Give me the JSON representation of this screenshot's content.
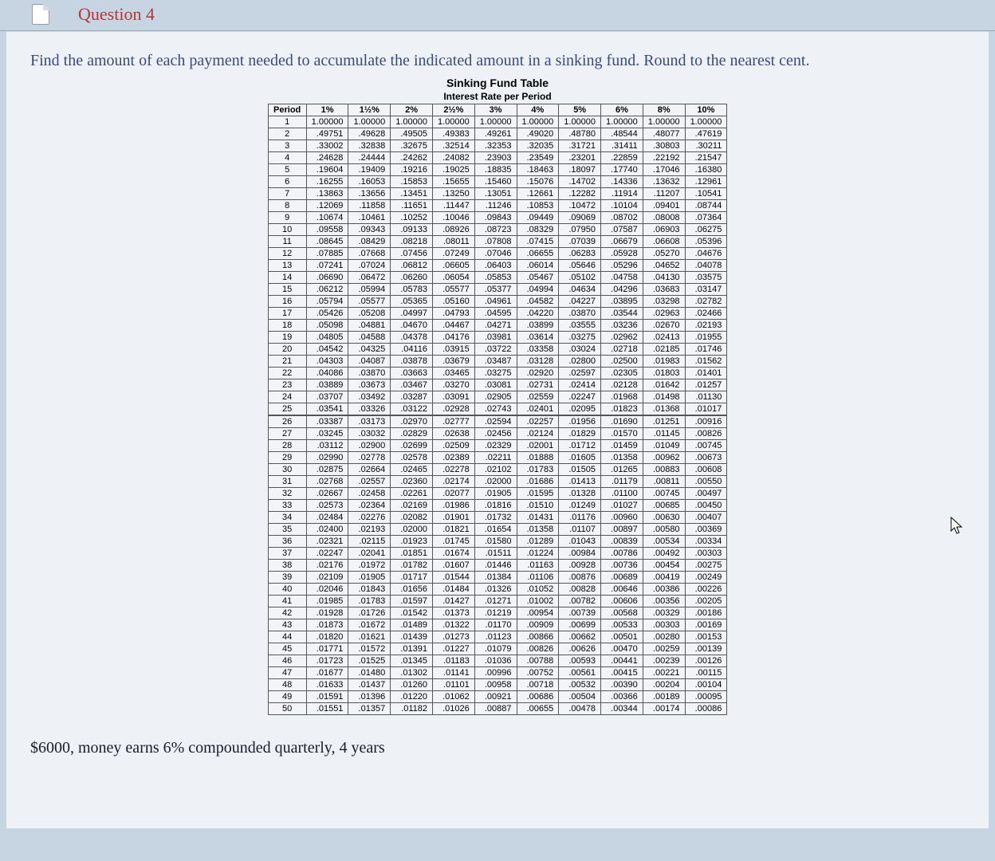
{
  "question_label": "Question 4",
  "prompt": "Find the amount of each payment needed to accumulate the indicated amount in a sinking fund. Round to the nearest cent.",
  "problem": "$6000, money earns 6% compounded quarterly, 4 years",
  "chart_data": {
    "type": "table",
    "title": "Sinking Fund Table",
    "subtitle": "Interest Rate per Period",
    "columns": [
      "Period",
      "1%",
      "1½%",
      "2%",
      "2½%",
      "3%",
      "4%",
      "5%",
      "6%",
      "8%",
      "10%"
    ],
    "rows": [
      [
        "1",
        "1.00000",
        "1.00000",
        "1.00000",
        "1.00000",
        "1.00000",
        "1.00000",
        "1.00000",
        "1.00000",
        "1.00000",
        "1.00000"
      ],
      [
        "2",
        ".49751",
        ".49628",
        ".49505",
        ".49383",
        ".49261",
        ".49020",
        ".48780",
        ".48544",
        ".48077",
        ".47619"
      ],
      [
        "3",
        ".33002",
        ".32838",
        ".32675",
        ".32514",
        ".32353",
        ".32035",
        ".31721",
        ".31411",
        ".30803",
        ".30211"
      ],
      [
        "4",
        ".24628",
        ".24444",
        ".24262",
        ".24082",
        ".23903",
        ".23549",
        ".23201",
        ".22859",
        ".22192",
        ".21547"
      ],
      [
        "5",
        ".19604",
        ".19409",
        ".19216",
        ".19025",
        ".18835",
        ".18463",
        ".18097",
        ".17740",
        ".17046",
        ".16380"
      ],
      [
        "6",
        ".16255",
        ".16053",
        ".15853",
        ".15655",
        ".15460",
        ".15076",
        ".14702",
        ".14336",
        ".13632",
        ".12961"
      ],
      [
        "7",
        ".13863",
        ".13656",
        ".13451",
        ".13250",
        ".13051",
        ".12661",
        ".12282",
        ".11914",
        ".11207",
        ".10541"
      ],
      [
        "8",
        ".12069",
        ".11858",
        ".11651",
        ".11447",
        ".11246",
        ".10853",
        ".10472",
        ".10104",
        ".09401",
        ".08744"
      ],
      [
        "9",
        ".10674",
        ".10461",
        ".10252",
        ".10046",
        ".09843",
        ".09449",
        ".09069",
        ".08702",
        ".08008",
        ".07364"
      ],
      [
        "10",
        ".09558",
        ".09343",
        ".09133",
        ".08926",
        ".08723",
        ".08329",
        ".07950",
        ".07587",
        ".06903",
        ".06275"
      ],
      [
        "11",
        ".08645",
        ".08429",
        ".08218",
        ".08011",
        ".07808",
        ".07415",
        ".07039",
        ".06679",
        ".06608",
        ".05396"
      ],
      [
        "12",
        ".07885",
        ".07668",
        ".07456",
        ".07249",
        ".07046",
        ".06655",
        ".06283",
        ".05928",
        ".05270",
        ".04676"
      ],
      [
        "13",
        ".07241",
        ".07024",
        ".06812",
        ".06605",
        ".06403",
        ".06014",
        ".05646",
        ".05296",
        ".04652",
        ".04078"
      ],
      [
        "14",
        ".06690",
        ".06472",
        ".06260",
        ".06054",
        ".05853",
        ".05467",
        ".05102",
        ".04758",
        ".04130",
        ".03575"
      ],
      [
        "15",
        ".06212",
        ".05994",
        ".05783",
        ".05577",
        ".05377",
        ".04994",
        ".04634",
        ".04296",
        ".03683",
        ".03147"
      ],
      [
        "16",
        ".05794",
        ".05577",
        ".05365",
        ".05160",
        ".04961",
        ".04582",
        ".04227",
        ".03895",
        ".03298",
        ".02782"
      ],
      [
        "17",
        ".05426",
        ".05208",
        ".04997",
        ".04793",
        ".04595",
        ".04220",
        ".03870",
        ".03544",
        ".02963",
        ".02466"
      ],
      [
        "18",
        ".05098",
        ".04881",
        ".04670",
        ".04467",
        ".04271",
        ".03899",
        ".03555",
        ".03236",
        ".02670",
        ".02193"
      ],
      [
        "19",
        ".04805",
        ".04588",
        ".04378",
        ".04176",
        ".03981",
        ".03614",
        ".03275",
        ".02962",
        ".02413",
        ".01955"
      ],
      [
        "20",
        ".04542",
        ".04325",
        ".04116",
        ".03915",
        ".03722",
        ".03358",
        ".03024",
        ".02718",
        ".02185",
        ".01746"
      ],
      [
        "21",
        ".04303",
        ".04087",
        ".03878",
        ".03679",
        ".03487",
        ".03128",
        ".02800",
        ".02500",
        ".01983",
        ".01562"
      ],
      [
        "22",
        ".04086",
        ".03870",
        ".03663",
        ".03465",
        ".03275",
        ".02920",
        ".02597",
        ".02305",
        ".01803",
        ".01401"
      ],
      [
        "23",
        ".03889",
        ".03673",
        ".03467",
        ".03270",
        ".03081",
        ".02731",
        ".02414",
        ".02128",
        ".01642",
        ".01257"
      ],
      [
        "24",
        ".03707",
        ".03492",
        ".03287",
        ".03091",
        ".02905",
        ".02559",
        ".02247",
        ".01968",
        ".01498",
        ".01130"
      ],
      [
        "25",
        ".03541",
        ".03326",
        ".03122",
        ".02928",
        ".02743",
        ".02401",
        ".02095",
        ".01823",
        ".01368",
        ".01017"
      ],
      [
        "26",
        ".03387",
        ".03173",
        ".02970",
        ".02777",
        ".02594",
        ".02257",
        ".01956",
        ".01690",
        ".01251",
        ".00916"
      ],
      [
        "27",
        ".03245",
        ".03032",
        ".02829",
        ".02638",
        ".02456",
        ".02124",
        ".01829",
        ".01570",
        ".01145",
        ".00826"
      ],
      [
        "28",
        ".03112",
        ".02900",
        ".02699",
        ".02509",
        ".02329",
        ".02001",
        ".01712",
        ".01459",
        ".01049",
        ".00745"
      ],
      [
        "29",
        ".02990",
        ".02778",
        ".02578",
        ".02389",
        ".02211",
        ".01888",
        ".01605",
        ".01358",
        ".00962",
        ".00673"
      ],
      [
        "30",
        ".02875",
        ".02664",
        ".02465",
        ".02278",
        ".02102",
        ".01783",
        ".01505",
        ".01265",
        ".00883",
        ".00608"
      ],
      [
        "31",
        ".02768",
        ".02557",
        ".02360",
        ".02174",
        ".02000",
        ".01686",
        ".01413",
        ".01179",
        ".00811",
        ".00550"
      ],
      [
        "32",
        ".02667",
        ".02458",
        ".02261",
        ".02077",
        ".01905",
        ".01595",
        ".01328",
        ".01100",
        ".00745",
        ".00497"
      ],
      [
        "33",
        ".02573",
        ".02364",
        ".02169",
        ".01986",
        ".01816",
        ".01510",
        ".01249",
        ".01027",
        ".00685",
        ".00450"
      ],
      [
        "34",
        ".02484",
        ".02276",
        ".02082",
        ".01901",
        ".01732",
        ".01431",
        ".01176",
        ".00960",
        ".00630",
        ".00407"
      ],
      [
        "35",
        ".02400",
        ".02193",
        ".02000",
        ".01821",
        ".01654",
        ".01358",
        ".01107",
        ".00897",
        ".00580",
        ".00369"
      ],
      [
        "36",
        ".02321",
        ".02115",
        ".01923",
        ".01745",
        ".01580",
        ".01289",
        ".01043",
        ".00839",
        ".00534",
        ".00334"
      ],
      [
        "37",
        ".02247",
        ".02041",
        ".01851",
        ".01674",
        ".01511",
        ".01224",
        ".00984",
        ".00786",
        ".00492",
        ".00303"
      ],
      [
        "38",
        ".02176",
        ".01972",
        ".01782",
        ".01607",
        ".01446",
        ".01163",
        ".00928",
        ".00736",
        ".00454",
        ".00275"
      ],
      [
        "39",
        ".02109",
        ".01905",
        ".01717",
        ".01544",
        ".01384",
        ".01106",
        ".00876",
        ".00689",
        ".00419",
        ".00249"
      ],
      [
        "40",
        ".02046",
        ".01843",
        ".01656",
        ".01484",
        ".01326",
        ".01052",
        ".00828",
        ".00646",
        ".00386",
        ".00226"
      ],
      [
        "41",
        ".01985",
        ".01783",
        ".01597",
        ".01427",
        ".01271",
        ".01002",
        ".00782",
        ".00606",
        ".00356",
        ".00205"
      ],
      [
        "42",
        ".01928",
        ".01726",
        ".01542",
        ".01373",
        ".01219",
        ".00954",
        ".00739",
        ".00568",
        ".00329",
        ".00186"
      ],
      [
        "43",
        ".01873",
        ".01672",
        ".01489",
        ".01322",
        ".01170",
        ".00909",
        ".00699",
        ".00533",
        ".00303",
        ".00169"
      ],
      [
        "44",
        ".01820",
        ".01621",
        ".01439",
        ".01273",
        ".01123",
        ".00866",
        ".00662",
        ".00501",
        ".00280",
        ".00153"
      ],
      [
        "45",
        ".01771",
        ".01572",
        ".01391",
        ".01227",
        ".01079",
        ".00826",
        ".00626",
        ".00470",
        ".00259",
        ".00139"
      ],
      [
        "46",
        ".01723",
        ".01525",
        ".01345",
        ".01183",
        ".01036",
        ".00788",
        ".00593",
        ".00441",
        ".00239",
        ".00126"
      ],
      [
        "47",
        ".01677",
        ".01480",
        ".01302",
        ".01141",
        ".00996",
        ".00752",
        ".00561",
        ".00415",
        ".00221",
        ".00115"
      ],
      [
        "48",
        ".01633",
        ".01437",
        ".01260",
        ".01101",
        ".00958",
        ".00718",
        ".00532",
        ".00390",
        ".00204",
        ".00104"
      ],
      [
        "49",
        ".01591",
        ".01396",
        ".01220",
        ".01062",
        ".00921",
        ".00686",
        ".00504",
        ".00366",
        ".00189",
        ".00095"
      ],
      [
        "50",
        ".01551",
        ".01357",
        ".01182",
        ".01026",
        ".00887",
        ".00655",
        ".00478",
        ".00344",
        ".00174",
        ".00086"
      ]
    ]
  }
}
